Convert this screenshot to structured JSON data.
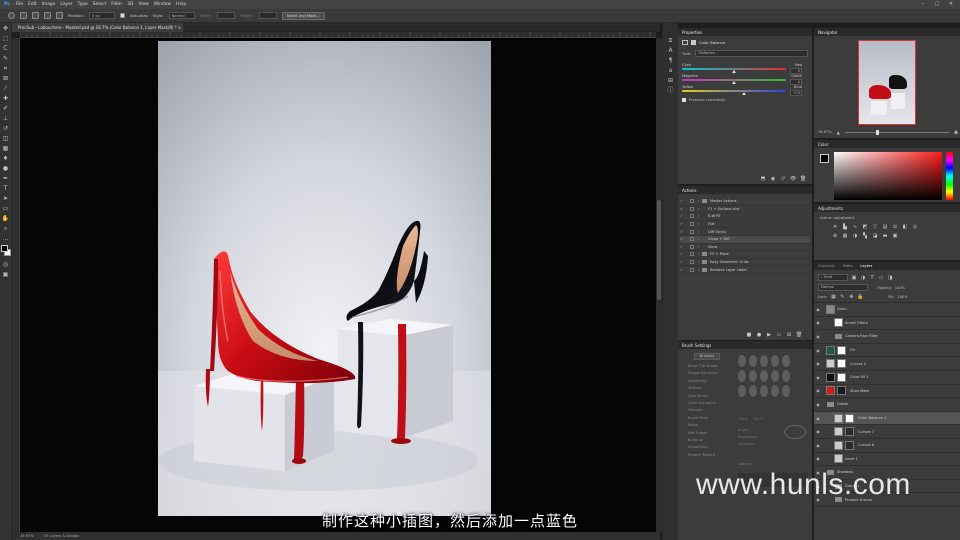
{
  "menubar": {
    "items": [
      "File",
      "Edit",
      "Image",
      "Layer",
      "Type",
      "Select",
      "Filter",
      "3D",
      "View",
      "Window",
      "Help"
    ]
  },
  "options": {
    "position_label": "Position:",
    "position_value": "0 px",
    "antialias_label": "Anti-alias",
    "style_label": "Style:",
    "style_value": "Normal",
    "width_label": "Width:",
    "height_label": "Height:",
    "select_mask_label": "Select and Mask..."
  },
  "document": {
    "tab_title": "ProcSub - Labouchere - Masked.psd @ 16.7% (Color Balance 1, Layer Mask/8) *",
    "zoom": "16.67%",
    "doc_info": "37 Layers & Groups"
  },
  "properties": {
    "panel_title": "Properties",
    "adjustment_title": "Color Balance",
    "tone_label": "Tone:",
    "tone_value": "Midtones",
    "sliders": [
      {
        "left": "Cyan",
        "right": "Red",
        "value": "0",
        "position": 0.5,
        "gradient": [
          "#00c8d6",
          "#e03030"
        ]
      },
      {
        "left": "Magenta",
        "right": "Green",
        "value": "0",
        "position": 0.5,
        "gradient": [
          "#d030c0",
          "#30c030"
        ]
      },
      {
        "left": "Yellow",
        "right": "Blue",
        "value": "+23",
        "position": 0.6,
        "gradient": [
          "#e0d020",
          "#3040e0"
        ]
      }
    ],
    "preserve_label": "Preserve Luminosity"
  },
  "navigator": {
    "panel_title": "Navigator",
    "zoom": "16.67%"
  },
  "color": {
    "panel_title": "Color",
    "hue_color": "#ff1a1a"
  },
  "adjustments": {
    "panel_title": "Adjustments",
    "add_label": "Add an adjustment"
  },
  "actions": {
    "panel_title": "Actions",
    "items": [
      {
        "label": "Master Actions",
        "indent": 0,
        "folder": true
      },
      {
        "label": "F1 + Surface blur",
        "indent": 1,
        "folder": false
      },
      {
        "label": "B-W RT",
        "indent": 1,
        "folder": false
      },
      {
        "label": "Flat",
        "indent": 1,
        "folder": false
      },
      {
        "label": "Diff Strain",
        "indent": 1,
        "folder": false
      },
      {
        "label": "Clone + Diff",
        "indent": 1,
        "folder": false
      },
      {
        "label": "Skew",
        "indent": 1,
        "folder": false
      },
      {
        "label": "F5 + Mask",
        "indent": 0,
        "folder": true
      },
      {
        "label": "Easy Geometric Grids",
        "indent": 0,
        "folder": true
      },
      {
        "label": "Remove Layer Label",
        "indent": 0,
        "folder": true
      }
    ]
  },
  "brush_settings": {
    "panel_title": "Brush Settings",
    "brushes_btn": "Brushes",
    "options": [
      "Brush Tip Shape",
      "Shape Dynamics",
      "Scattering",
      "Texture",
      "Dual Brush",
      "Color Dynamics",
      "Transfer",
      "Brush Pose",
      "Noise",
      "Wet Edges",
      "Build-up",
      "Smoothing",
      "Protect Texture"
    ],
    "angle_label": "Angle:",
    "roundness_label": "Roundness:",
    "hardness_label": "Hardness",
    "spacing_label": "Spacing",
    "flip_x": "Flip X",
    "flip_y": "Flip Y"
  },
  "layers": {
    "tabs": [
      "Channels",
      "Paths",
      "Layers"
    ],
    "filter_label": "Kind",
    "blend_mode": "Normal",
    "opacity_label": "Opacity:",
    "opacity_value": "100%",
    "lock_label": "Lock:",
    "fill_label": "Fill:",
    "fill_value": "100%",
    "items": [
      {
        "name": "Grain",
        "indent": 0,
        "thumb": "#888888",
        "mask": "",
        "selected": false
      },
      {
        "name": "Smart Filters",
        "indent": 1,
        "thumb": "#ffffff",
        "mask": "",
        "selected": false
      },
      {
        "name": "Camera Raw Filter",
        "indent": 1,
        "thumb": "",
        "mask": "",
        "selected": false
      },
      {
        "name": "Fill",
        "indent": 0,
        "thumb": "#1f5a3a",
        "mask": "#ffffff",
        "selected": false
      },
      {
        "name": "Curves 2",
        "indent": 0,
        "thumb": "#cccccc",
        "mask": "#ffffff",
        "selected": false
      },
      {
        "name": "Color Fill 1",
        "indent": 0,
        "thumb": "#111111",
        "mask": "#ffffff",
        "selected": false
      },
      {
        "name": "Shoe Mask",
        "indent": 0,
        "thumb": "#d41a1a",
        "mask": "#1a1a1a",
        "selected": false
      },
      {
        "name": "Grade",
        "indent": 0,
        "thumb": "",
        "mask": "",
        "selected": false
      },
      {
        "name": "Color Balance 1",
        "indent": 1,
        "thumb": "#cccccc",
        "mask": "#ffffff",
        "selected": true
      },
      {
        "name": "Curves 7",
        "indent": 1,
        "thumb": "#cccccc",
        "mask": "#2a2a2a",
        "selected": false
      },
      {
        "name": "Curves 6",
        "indent": 1,
        "thumb": "#cccccc",
        "mask": "#2a2a2a",
        "selected": false
      },
      {
        "name": "Level 1",
        "indent": 1,
        "thumb": "#cccccc",
        "mask": "",
        "selected": false
      },
      {
        "name": "Shadows",
        "indent": 0,
        "thumb": "",
        "mask": "",
        "selected": false
      },
      {
        "name": "Group 1",
        "indent": 1,
        "thumb": "",
        "mask": "",
        "selected": false
      },
      {
        "name": "Product X-shoe",
        "indent": 1,
        "thumb": "",
        "mask": "",
        "selected": false
      }
    ]
  },
  "overlay": {
    "subtitle": "制作这种小插图，然后添加一点蓝色",
    "watermark": "www.hunls.com"
  }
}
